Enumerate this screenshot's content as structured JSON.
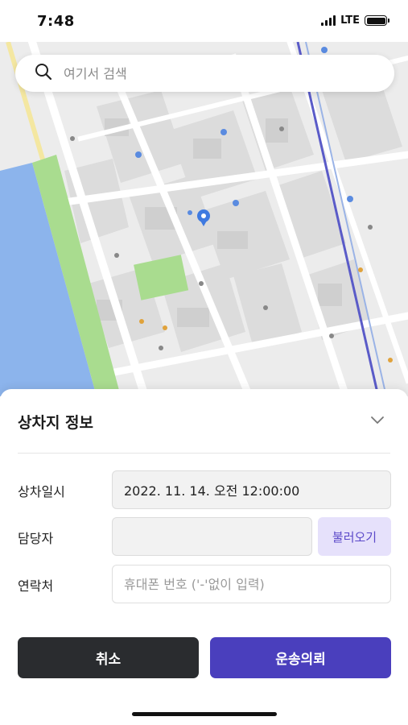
{
  "status": {
    "time": "7:48",
    "network": "LTE"
  },
  "search": {
    "placeholder": "여기서 검색"
  },
  "sheet": {
    "title": "상차지 정보",
    "datetime_label": "상차일시",
    "datetime_value": "2022. 11. 14. 오전 12:00:00",
    "manager_label": "담당자",
    "manager_value": "",
    "load_button": "불러오기",
    "contact_label": "연락처",
    "contact_placeholder": "휴대폰 번호 ('-'없이 입력)"
  },
  "actions": {
    "cancel": "취소",
    "request": "운송의뢰"
  },
  "colors": {
    "primary": "#4a3fbd",
    "dark": "#2a2c2f",
    "load_bg": "#e6e1fb",
    "river": "#8cb4ec",
    "park": "#a9dc8f"
  },
  "icons": {
    "search": "search-icon",
    "chevron": "chevron-down-icon",
    "marker": "map-marker-icon"
  }
}
